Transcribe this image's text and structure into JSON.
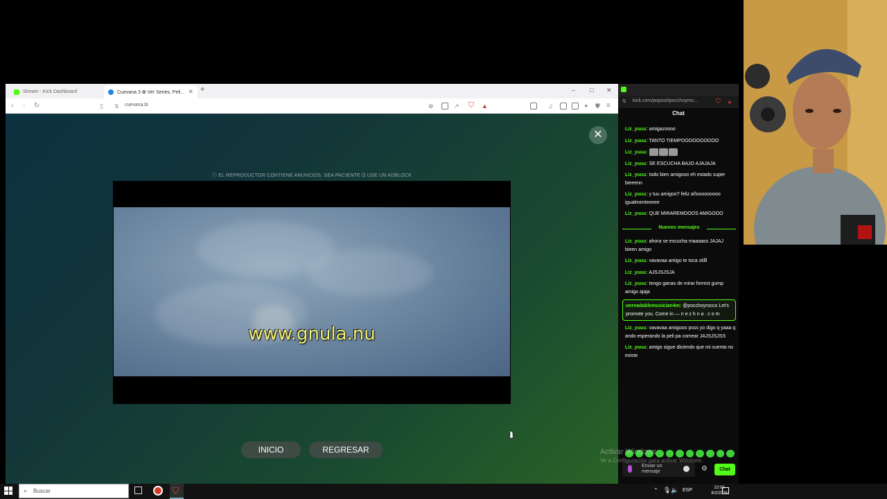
{
  "browser": {
    "tabs": [
      {
        "label": "Stream - Kick Dashboard",
        "active": false
      },
      {
        "label": "Cuevana 3 ✿ Ver Series, Peli...",
        "active": true
      }
    ],
    "new_tab": "+",
    "url": "cuevana.bi",
    "win_controls": {
      "minimize": "–",
      "maximize": "□",
      "close": "✕"
    }
  },
  "page": {
    "ad_notice": "ⓘ EL REPRODUCTOR CONTIENE ANUNCIOS, SEA PACIENTE O USE UN ADBLOCK",
    "watermark": "www.gnula.nu",
    "close_symbol": "✕",
    "buttons": {
      "home": "INICIO",
      "back": "REGRESAR"
    }
  },
  "chat": {
    "url": "kick.com/popout/pocchoyroc...",
    "title": "Chat",
    "messages_before": [
      {
        "user": "Liz_yuuu:",
        "text": "amigazoooo"
      },
      {
        "user": "Liz_yuuu:",
        "text": "TANTO TIEMPOOOOOOOOOO"
      },
      {
        "user": "Liz_yuuu:",
        "text": "",
        "emotes": 3
      },
      {
        "user": "Liz_yuuu:",
        "text": "SE ESCUCHA BAJO AJAJAJA"
      },
      {
        "user": "Liz_yuuu:",
        "text": "todo bien amigooo eh estado super bieeenn"
      },
      {
        "user": "Liz_yuuu:",
        "text": "y tuu amigoo? feliz añooooooooo igualmenteeeee"
      },
      {
        "user": "Liz_yuuu:",
        "text": "QUE MIRAREMOOOS AMIGOOO"
      }
    ],
    "new_messages_label": "Nuevos mensajes",
    "messages_after": [
      {
        "user": "Liz_yuuu:",
        "text": "ahora se escucha maaaass JAJAJ bieen amigo"
      },
      {
        "user": "Liz_yuuu:",
        "text": "vavavaa amigo te toca stilll"
      },
      {
        "user": "Liz_yuuu:",
        "text": "AJSJSJSJA"
      },
      {
        "user": "Liz_yuuu:",
        "text": "tengo ganas de mirar forrest gump amigo ajaja"
      },
      {
        "user": "unreadablemusician4m:",
        "text": "@pocchoyrocco Let's promote you. Come in — n e z h n a . c o m",
        "highlight": true
      },
      {
        "user": "Liz_yuuu:",
        "text": "vavavaa amigooo psss yo digo q yaaa q ando esperando la peli pa comear JAJSJSJSS"
      },
      {
        "user": "Liz_yuuu:",
        "text": "amigo sigue diciendo que mi cuenta no existe"
      }
    ],
    "input_placeholder": "Enviar un mensaje",
    "send_label": "Chat"
  },
  "activate_windows": {
    "line1": "Activar Windows",
    "line2": "Ve a Configuración para activar Windows."
  },
  "taskbar": {
    "search_placeholder": "Buscar",
    "language": "ESP",
    "time": "22:02",
    "date": "8/2/2026"
  },
  "colors": {
    "kick_green": "#53fc18",
    "player_bg": "#000000"
  }
}
